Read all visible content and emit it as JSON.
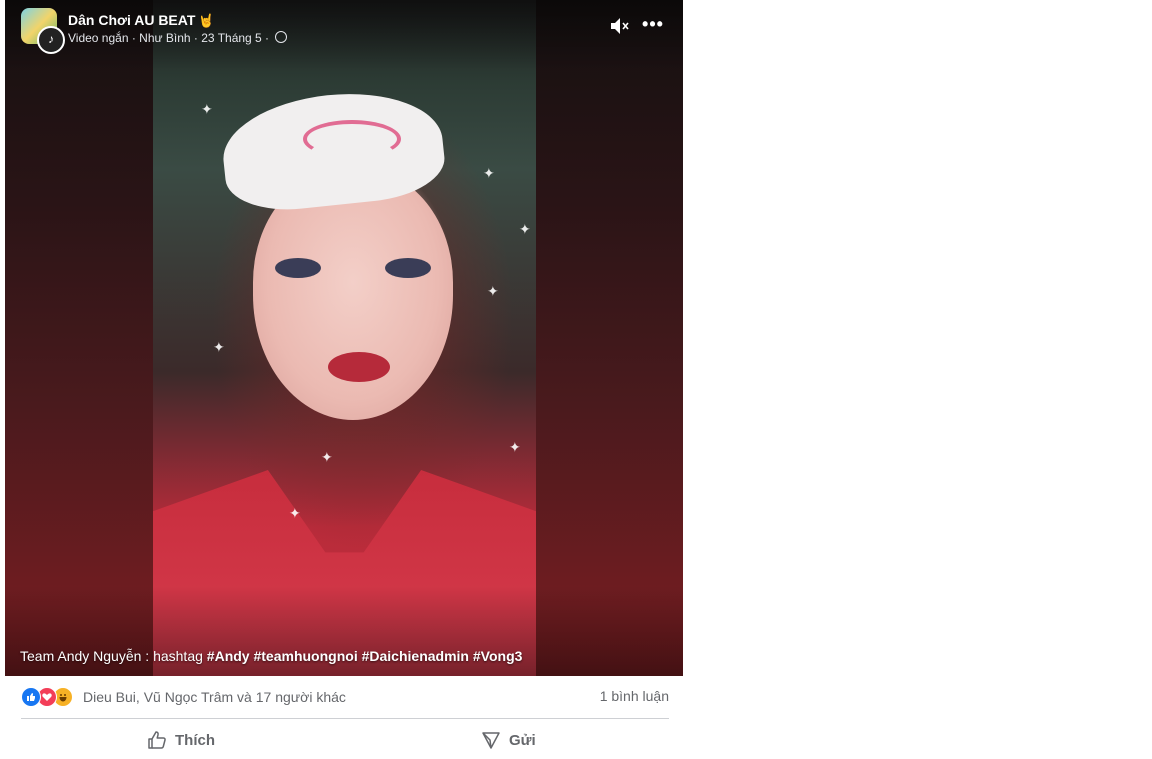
{
  "post": {
    "page_name": "Dân Chơi AU BEAT",
    "page_name_emoji": "🤘",
    "meta_text": "Video ngắn · Như Bình · 23 Tháng 5 · ",
    "caption": {
      "prefix": "Team Andy Nguyễn : hashtag ",
      "hashtags": [
        "#Andy",
        "#teamhuongnoi",
        "#Daichienadmin",
        "#Vong3"
      ]
    },
    "icons": {
      "audience": "globe-icon",
      "volume": "volume-muted-icon",
      "more": "more-options-icon"
    }
  },
  "reactions": {
    "types": [
      "like",
      "love",
      "haha"
    ],
    "summary": "Dieu Bui, Vũ Ngọc Trâm và 17 người khác",
    "comments": "1 bình luận"
  },
  "actions": {
    "like_label": "Thích",
    "send_label": "Gửi"
  },
  "colors": {
    "like_blue": "#1877f2",
    "love_red": "#f33e58",
    "haha_yellow": "#f7b125",
    "secondary_text": "#65676b"
  }
}
